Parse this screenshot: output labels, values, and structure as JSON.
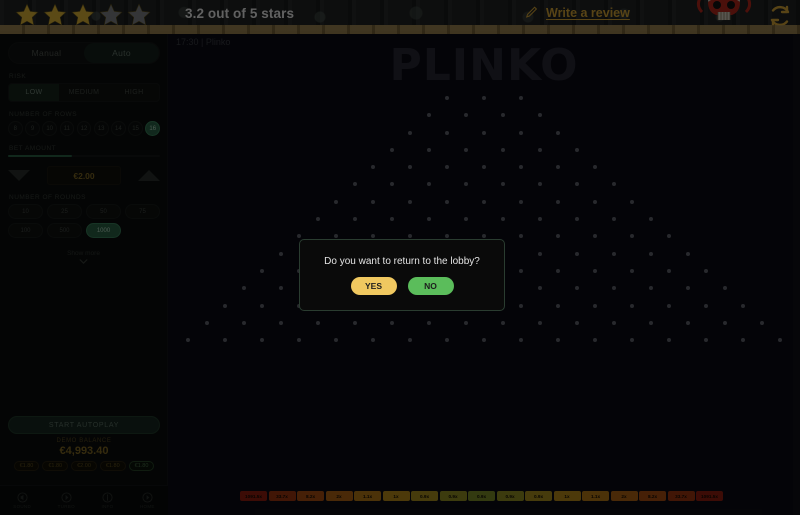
{
  "review_bar": {
    "rating_value": 3.2,
    "rating_text": "3.2 out of 5 stars",
    "stars_filled": 3,
    "stars_total": 5,
    "write_review_label": "Write a review",
    "pencil_icon": "pencil-icon",
    "refresh_icon": "refresh-icon",
    "skull_icon": "skull-decoration",
    "star_fill_color": "#f0c23c",
    "star_empty_color": "#8a8d92",
    "link_color": "#e8b33a"
  },
  "panel": {
    "mode": {
      "manual_label": "Manual",
      "auto_label": "Auto",
      "selected": "Auto"
    },
    "risk": {
      "label": "RISK",
      "options": [
        "LOW",
        "MEDIUM",
        "HIGH"
      ],
      "selected": "LOW"
    },
    "rows": {
      "label": "NUMBER OF ROWS",
      "options": [
        "8",
        "9",
        "10",
        "11",
        "12",
        "13",
        "14",
        "15",
        "16"
      ],
      "selected": "16"
    },
    "bet": {
      "label": "BET AMOUNT",
      "value": "€2.00",
      "decrease_icon": "triangle-down-icon",
      "increase_icon": "triangle-up-icon",
      "progress_percent": 42
    },
    "rounds": {
      "label": "NUMBER OF ROUNDS",
      "options": [
        "10",
        "25",
        "50",
        "75",
        "100",
        "500",
        "1000"
      ],
      "selected": "1000"
    },
    "show_more_label": "Show more",
    "show_more_icon": "chevron-down-icon",
    "start_button_label": "START AUTOPLAY",
    "balance": {
      "label": "DEMO BALANCE",
      "amount": "€4,993.40"
    },
    "bet_history": [
      "€1.80",
      "€1.80",
      "€2.00",
      "€1.80",
      "€1.80"
    ],
    "bottom_nav": [
      {
        "icon": "sound-icon",
        "label": "SOUND"
      },
      {
        "icon": "turbo-icon",
        "label": "TURBO"
      },
      {
        "icon": "info-icon",
        "label": "INFO"
      },
      {
        "icon": "home-icon",
        "label": "HOME"
      }
    ]
  },
  "game": {
    "clock": "17:30",
    "separator": "|",
    "title": "Plinko",
    "header_text": "17:30  |  Plinko",
    "logo": "PLINKO",
    "peg_rows": [
      3,
      4,
      5,
      6,
      7,
      8,
      9,
      10,
      11,
      12,
      13,
      14,
      15,
      16,
      17
    ],
    "multipliers": [
      "1091.5x",
      "33.7x",
      "8.2x",
      "2x",
      "1.1x",
      "1x",
      "0.9x",
      "0.9x",
      "0.9x",
      "0.9x",
      "0.9x",
      "1x",
      "1.1x",
      "2x",
      "8.2x",
      "33.7x",
      "1091.5x"
    ],
    "multiplier_colors": [
      "#9e2110",
      "#ab3b11",
      "#b85614",
      "#c06c15",
      "#c68318",
      "#c8961b",
      "#b79c20",
      "#9e9b25",
      "#86992a",
      "#9e9b25",
      "#b79c20",
      "#c8961b",
      "#c68318",
      "#c06c15",
      "#b85614",
      "#ab3b11",
      "#9e2110"
    ]
  },
  "modal": {
    "message": "Do you want to return to the lobby?",
    "yes_label": "YES",
    "no_label": "NO",
    "yes_color": "#f0c860",
    "no_color": "#5bbd5b"
  }
}
